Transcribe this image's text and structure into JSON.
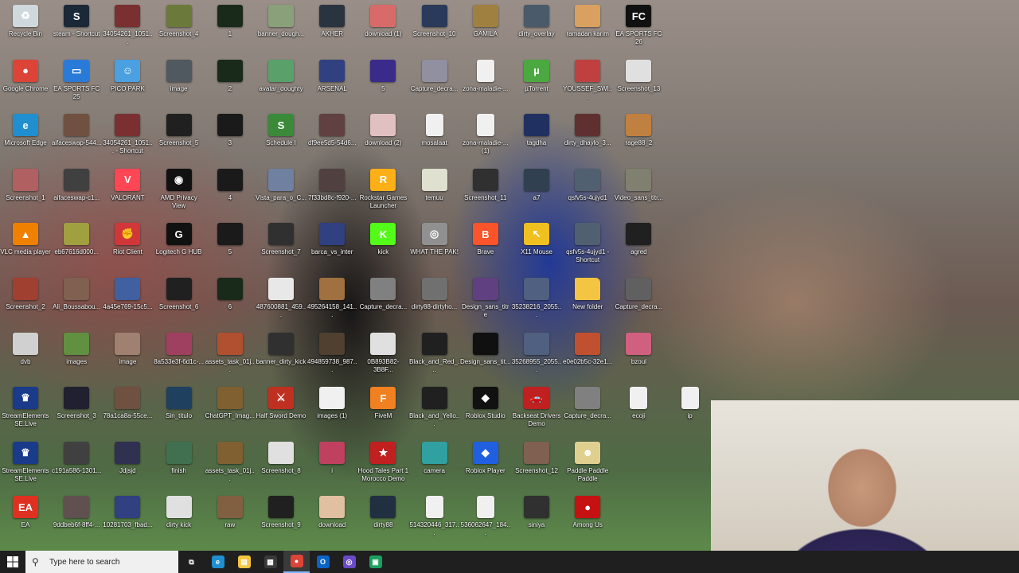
{
  "desktop": {
    "icons": [
      {
        "label": "Recycle Bin",
        "icon": "recycle-bin-icon",
        "color": "#cfd8dc",
        "glyph": "♻"
      },
      {
        "label": "steam - Shortcut",
        "icon": "steam-icon",
        "color": "#1b2838",
        "glyph": "S"
      },
      {
        "label": "34054261_1051...",
        "icon": "image-file-icon",
        "color": "#7a3030",
        "glyph": ""
      },
      {
        "label": "Screenshot_4",
        "icon": "image-file-icon",
        "color": "#6b7a3a",
        "glyph": ""
      },
      {
        "label": "1",
        "icon": "image-file-icon",
        "color": "#1a2a1a",
        "glyph": ""
      },
      {
        "label": "banner_dough...",
        "icon": "image-file-icon",
        "color": "#8aa07a",
        "glyph": ""
      },
      {
        "label": "AKHER",
        "icon": "image-file-icon",
        "color": "#2a3340",
        "glyph": ""
      },
      {
        "label": "download (1)",
        "icon": "image-file-icon",
        "color": "#d86a6a",
        "glyph": ""
      },
      {
        "label": "Screenshot_10",
        "icon": "image-file-icon",
        "color": "#2a3a5a",
        "glyph": ""
      },
      {
        "label": "GAMILA",
        "icon": "image-file-icon",
        "color": "#a08040",
        "glyph": ""
      },
      {
        "label": "dirty_overlay",
        "icon": "image-file-icon",
        "color": "#4a5a6a",
        "glyph": ""
      },
      {
        "label": "ramadan karim",
        "icon": "image-file-icon",
        "color": "#d9a060",
        "glyph": ""
      },
      {
        "label": "EA SPORTS FC 26",
        "icon": "ea-fc-icon",
        "color": "#111111",
        "glyph": "FC"
      },
      {
        "label": "Google Chrome",
        "icon": "chrome-icon",
        "color": "#db4437",
        "glyph": "●"
      },
      {
        "label": "EA SPORTS FC 25",
        "icon": "shortcut-icon",
        "color": "#2a7ad8",
        "glyph": "▭"
      },
      {
        "label": "PICO PARK",
        "icon": "pico-park-icon",
        "color": "#4aa0e0",
        "glyph": "☺"
      },
      {
        "label": "image",
        "icon": "image-file-icon",
        "color": "#505860",
        "glyph": ""
      },
      {
        "label": "2",
        "icon": "image-file-icon",
        "color": "#1a2a1a",
        "glyph": ""
      },
      {
        "label": "avatar_doughty",
        "icon": "image-file-icon",
        "color": "#5aa06a",
        "glyph": ""
      },
      {
        "label": "ARSENAL",
        "icon": "image-file-icon",
        "color": "#304080",
        "glyph": ""
      },
      {
        "label": "5",
        "icon": "image-file-icon",
        "color": "#3a2a8a",
        "glyph": ""
      },
      {
        "label": "Capture_decra...",
        "icon": "image-file-icon",
        "color": "#9090a0",
        "glyph": ""
      },
      {
        "label": "zona-maladie-...",
        "icon": "file-icon",
        "color": "#f0f0f0",
        "glyph": ""
      },
      {
        "label": "µTorrent",
        "icon": "utorrent-icon",
        "color": "#4ca840",
        "glyph": "µ"
      },
      {
        "label": "YOUSSEF_SWI...",
        "icon": "image-file-icon",
        "color": "#c04040",
        "glyph": ""
      },
      {
        "label": "Screenshot_13",
        "icon": "image-file-icon",
        "color": "#e0e0e0",
        "glyph": ""
      },
      {
        "label": "Microsoft Edge",
        "icon": "edge-icon",
        "color": "#1f8fd0",
        "glyph": "e"
      },
      {
        "label": "aifaceswap-544...",
        "icon": "image-file-icon",
        "color": "#705040",
        "glyph": ""
      },
      {
        "label": "34054261_1051... - Shortcut",
        "icon": "image-file-icon",
        "color": "#7a3030",
        "glyph": ""
      },
      {
        "label": "Screenshot_5",
        "icon": "image-file-icon",
        "color": "#202020",
        "glyph": ""
      },
      {
        "label": "3",
        "icon": "image-file-icon",
        "color": "#1a1a1a",
        "glyph": ""
      },
      {
        "label": "Schedule I",
        "icon": "schedule-icon",
        "color": "#3a8a3a",
        "glyph": "S"
      },
      {
        "label": "df9ee5d5-54d6...",
        "icon": "image-file-icon",
        "color": "#604040",
        "glyph": ""
      },
      {
        "label": "download (2)",
        "icon": "image-file-icon",
        "color": "#e0c0c0",
        "glyph": ""
      },
      {
        "label": "mosalaat",
        "icon": "file-icon",
        "color": "#f0f0f0",
        "glyph": ""
      },
      {
        "label": "zona-maladie-... (1)",
        "icon": "file-icon",
        "color": "#f0f0f0",
        "glyph": ""
      },
      {
        "label": "tagdha",
        "icon": "image-file-icon",
        "color": "#203060",
        "glyph": ""
      },
      {
        "label": "dirty_dhaylo_3...",
        "icon": "image-file-icon",
        "color": "#603030",
        "glyph": ""
      },
      {
        "label": "rage88_2",
        "icon": "image-file-icon",
        "color": "#c08040",
        "glyph": ""
      },
      {
        "label": "Screenshot_1",
        "icon": "image-file-icon",
        "color": "#b06060",
        "glyph": ""
      },
      {
        "label": "aifaceswap-c1...",
        "icon": "image-file-icon",
        "color": "#404040",
        "glyph": ""
      },
      {
        "label": "VALORANT",
        "icon": "valorant-icon",
        "color": "#ff4655",
        "glyph": "V"
      },
      {
        "label": "AMD Privacy View",
        "icon": "amd-icon",
        "color": "#111111",
        "glyph": "◉"
      },
      {
        "label": "4",
        "icon": "image-file-icon",
        "color": "#1a1a1a",
        "glyph": ""
      },
      {
        "label": "Vista_para_o_C...",
        "icon": "image-file-icon",
        "color": "#7080a0",
        "glyph": ""
      },
      {
        "label": "7f33bd8c-f920-...",
        "icon": "image-file-icon",
        "color": "#504040",
        "glyph": ""
      },
      {
        "label": "Rockstar Games Launcher",
        "icon": "rockstar-icon",
        "color": "#fcaf17",
        "glyph": "R"
      },
      {
        "label": "temuu",
        "icon": "image-file-icon",
        "color": "#e0e0d0",
        "glyph": ""
      },
      {
        "label": "Screenshot_11",
        "icon": "image-file-icon",
        "color": "#303030",
        "glyph": ""
      },
      {
        "label": "a7",
        "icon": "image-file-icon",
        "color": "#304050",
        "glyph": ""
      },
      {
        "label": "qsfv5s-4ujyd1",
        "icon": "image-file-icon",
        "color": "#506070",
        "glyph": ""
      },
      {
        "label": "Video_sans_titr...",
        "icon": "image-file-icon",
        "color": "#808070",
        "glyph": ""
      },
      {
        "label": "VLC media player",
        "icon": "vlc-icon",
        "color": "#f08000",
        "glyph": "▲"
      },
      {
        "label": "eb67616d000...",
        "icon": "image-file-icon",
        "color": "#a0a040",
        "glyph": ""
      },
      {
        "label": "Riot Client",
        "icon": "riot-icon",
        "color": "#d13639",
        "glyph": "✊"
      },
      {
        "label": "Logitech G HUB",
        "icon": "logitech-icon",
        "color": "#111111",
        "glyph": "G"
      },
      {
        "label": "5",
        "icon": "image-file-icon",
        "color": "#1a1a1a",
        "glyph": ""
      },
      {
        "label": "Screenshot_7",
        "icon": "image-file-icon",
        "color": "#303030",
        "glyph": ""
      },
      {
        "label": "barca_vs_inter",
        "icon": "image-file-icon",
        "color": "#304080",
        "glyph": ""
      },
      {
        "label": "kick",
        "icon": "kick-icon",
        "color": "#53fc18",
        "glyph": "K"
      },
      {
        "label": "WHAT THE PAK!",
        "icon": "game-icon",
        "color": "#909090",
        "glyph": "◎"
      },
      {
        "label": "Brave",
        "icon": "brave-icon",
        "color": "#fb542b",
        "glyph": "B"
      },
      {
        "label": "X11 Mouse",
        "icon": "cursor-icon",
        "color": "#f0c020",
        "glyph": "↖"
      },
      {
        "label": "qsfv5s-4ujyd1 - Shortcut",
        "icon": "image-file-icon",
        "color": "#506070",
        "glyph": ""
      },
      {
        "label": "agred",
        "icon": "image-file-icon",
        "color": "#202020",
        "glyph": ""
      },
      {
        "label": "Screenshot_2",
        "icon": "image-file-icon",
        "color": "#a04030",
        "glyph": ""
      },
      {
        "label": "Ali_Boussabou...",
        "icon": "image-file-icon",
        "color": "#806050",
        "glyph": ""
      },
      {
        "label": "4a45e769-15c5...",
        "icon": "image-file-icon",
        "color": "#4060a0",
        "glyph": ""
      },
      {
        "label": "Screenshot_6",
        "icon": "image-file-icon",
        "color": "#202020",
        "glyph": ""
      },
      {
        "label": "6",
        "icon": "image-file-icon",
        "color": "#1a2a1a",
        "glyph": ""
      },
      {
        "label": "487600881_459...",
        "icon": "image-file-icon",
        "color": "#e8e8e8",
        "glyph": ""
      },
      {
        "label": "495264158_141...",
        "icon": "image-file-icon",
        "color": "#a07040",
        "glyph": ""
      },
      {
        "label": "Capture_decra...",
        "icon": "image-file-icon",
        "color": "#808080",
        "glyph": ""
      },
      {
        "label": "dirty88-dirtyho...",
        "icon": "image-file-icon",
        "color": "#707070",
        "glyph": ""
      },
      {
        "label": "Design_sans_titre",
        "icon": "image-file-icon",
        "color": "#604080",
        "glyph": ""
      },
      {
        "label": "35238216_2055...",
        "icon": "image-file-icon",
        "color": "#506080",
        "glyph": ""
      },
      {
        "label": "New folder",
        "icon": "folder-icon",
        "color": "#f4c542",
        "glyph": ""
      },
      {
        "label": "Capture_decra...",
        "icon": "image-file-icon",
        "color": "#606060",
        "glyph": ""
      },
      {
        "label": "dvb",
        "icon": "image-file-icon",
        "color": "#d0d0d0",
        "glyph": ""
      },
      {
        "label": "images",
        "icon": "image-file-icon",
        "color": "#609040",
        "glyph": ""
      },
      {
        "label": "image",
        "icon": "image-file-icon",
        "color": "#a08070",
        "glyph": ""
      },
      {
        "label": "8a533e3f-6d1c-...",
        "icon": "image-file-icon",
        "color": "#a04060",
        "glyph": ""
      },
      {
        "label": "assets_task_01j...",
        "icon": "image-file-icon",
        "color": "#b05030",
        "glyph": ""
      },
      {
        "label": "banner_dirty_kick",
        "icon": "image-file-icon",
        "color": "#303030",
        "glyph": ""
      },
      {
        "label": "494859738_987...",
        "icon": "image-file-icon",
        "color": "#504030",
        "glyph": ""
      },
      {
        "label": "0B893B82-3B8F...",
        "icon": "image-file-icon",
        "color": "#e0e0e0",
        "glyph": ""
      },
      {
        "label": "Black_and_Red_...",
        "icon": "image-file-icon",
        "color": "#202020",
        "glyph": ""
      },
      {
        "label": "Design_sans_tit...",
        "icon": "image-file-icon",
        "color": "#101010",
        "glyph": ""
      },
      {
        "label": "35268955_2055...",
        "icon": "image-file-icon",
        "color": "#506080",
        "glyph": ""
      },
      {
        "label": "e0e02b5c-32e1...",
        "icon": "image-file-icon",
        "color": "#c05030",
        "glyph": ""
      },
      {
        "label": "bzoul",
        "icon": "image-file-icon",
        "color": "#d06080",
        "glyph": ""
      },
      {
        "label": "StreamElements SE.Live",
        "icon": "streamelements-icon",
        "color": "#1a3a8a",
        "glyph": "♛"
      },
      {
        "label": "Screenshot_3",
        "icon": "image-file-icon",
        "color": "#202030",
        "glyph": ""
      },
      {
        "label": "78a1ca8a-55ce...",
        "icon": "image-file-icon",
        "color": "#705040",
        "glyph": ""
      },
      {
        "label": "Sin_titulo",
        "icon": "image-file-icon",
        "color": "#204060",
        "glyph": ""
      },
      {
        "label": "ChatGPT_Imag...",
        "icon": "image-file-icon",
        "color": "#806030",
        "glyph": ""
      },
      {
        "label": "Half Sword Demo",
        "icon": "half-sword-icon",
        "color": "#c03020",
        "glyph": "⚔"
      },
      {
        "label": "images (1)",
        "icon": "image-file-icon",
        "color": "#f0f0f0",
        "glyph": ""
      },
      {
        "label": "FiveM",
        "icon": "fivem-icon",
        "color": "#f08020",
        "glyph": "F"
      },
      {
        "label": "Black_and_Yello...",
        "icon": "image-file-icon",
        "color": "#202020",
        "glyph": ""
      },
      {
        "label": "Roblox Studio",
        "icon": "roblox-studio-icon",
        "color": "#111111",
        "glyph": "◆"
      },
      {
        "label": "Backseat Drivers Demo",
        "icon": "game-icon",
        "color": "#c02020",
        "glyph": "🚗"
      },
      {
        "label": "Capture_decra...",
        "icon": "image-file-icon",
        "color": "#808080",
        "glyph": ""
      },
      {
        "label": "ecoji",
        "icon": "file-icon",
        "color": "#f0f0f0",
        "glyph": ""
      },
      {
        "label": "ip",
        "icon": "file-icon",
        "color": "#f0f0f0",
        "glyph": ""
      },
      {
        "label": "StreamElements SE.Live",
        "icon": "streamelements-icon",
        "color": "#1a3a8a",
        "glyph": "♛"
      },
      {
        "label": "c191a586-1301...",
        "icon": "image-file-icon",
        "color": "#404040",
        "glyph": ""
      },
      {
        "label": "Jdjsjd",
        "icon": "image-file-icon",
        "color": "#303050",
        "glyph": ""
      },
      {
        "label": "finish",
        "icon": "image-file-icon",
        "color": "#407050",
        "glyph": ""
      },
      {
        "label": "assets_task_01j...",
        "icon": "image-file-icon",
        "color": "#806030",
        "glyph": ""
      },
      {
        "label": "Screenshot_8",
        "icon": "image-file-icon",
        "color": "#e0e0e0",
        "glyph": ""
      },
      {
        "label": "i",
        "icon": "image-file-icon",
        "color": "#c04060",
        "glyph": ""
      },
      {
        "label": "Hood Tales Part 1 Morocco Demo",
        "icon": "game-icon",
        "color": "#c02020",
        "glyph": "★"
      },
      {
        "label": "camera",
        "icon": "image-file-icon",
        "color": "#30a0a0",
        "glyph": ""
      },
      {
        "label": "Roblox Player",
        "icon": "roblox-icon",
        "color": "#2060e0",
        "glyph": "◆"
      },
      {
        "label": "Screenshot_12",
        "icon": "image-file-icon",
        "color": "#806050",
        "glyph": ""
      },
      {
        "label": "Paddle Paddle Paddle",
        "icon": "game-icon",
        "color": "#e0d090",
        "glyph": "☻"
      },
      {
        "label": "EA",
        "icon": "ea-icon",
        "color": "#e03020",
        "glyph": "EA"
      },
      {
        "label": "9ddbeb6f-8ff4-...",
        "icon": "image-file-icon",
        "color": "#605050",
        "glyph": ""
      },
      {
        "label": "10281703_fbad...",
        "icon": "image-file-icon",
        "color": "#304080",
        "glyph": ""
      },
      {
        "label": "dirty kick",
        "icon": "image-file-icon",
        "color": "#e0e0e0",
        "glyph": ""
      },
      {
        "label": "raw",
        "icon": "image-file-icon",
        "color": "#806040",
        "glyph": ""
      },
      {
        "label": "Screenshot_9",
        "icon": "image-file-icon",
        "color": "#202020",
        "glyph": ""
      },
      {
        "label": "download",
        "icon": "image-file-icon",
        "color": "#e0c0a0",
        "glyph": ""
      },
      {
        "label": "dirty88",
        "icon": "image-file-icon",
        "color": "#203040",
        "glyph": ""
      },
      {
        "label": "514320446_317...",
        "icon": "file-icon",
        "color": "#f0f0f0",
        "glyph": ""
      },
      {
        "label": "536062647_184...",
        "icon": "file-icon",
        "color": "#f0f0f0",
        "glyph": ""
      },
      {
        "label": "siniya",
        "icon": "image-file-icon",
        "color": "#303030",
        "glyph": ""
      },
      {
        "label": "Among Us",
        "icon": "among-us-icon",
        "color": "#c51111",
        "glyph": "●"
      }
    ]
  },
  "taskbar": {
    "search_placeholder": "Type here to search",
    "apps": [
      {
        "name": "task-view-icon",
        "glyph": "⧉",
        "color": "#1f1f1f",
        "active": false
      },
      {
        "name": "edge-taskbar-icon",
        "glyph": "e",
        "color": "#1f8fd0",
        "active": false
      },
      {
        "name": "file-explorer-icon",
        "glyph": "▤",
        "color": "#f4c542",
        "active": false
      },
      {
        "name": "store-icon",
        "glyph": "▦",
        "color": "#3a3a3a",
        "active": false
      },
      {
        "name": "chrome-taskbar-icon",
        "glyph": "●",
        "color": "#db4437",
        "active": true
      },
      {
        "name": "outlook-icon",
        "glyph": "O",
        "color": "#0a64c8",
        "active": false
      },
      {
        "name": "app-icon",
        "glyph": "◎",
        "color": "#6a4ac8",
        "active": false
      },
      {
        "name": "calculator-icon",
        "glyph": "▣",
        "color": "#1aa060",
        "active": false
      }
    ]
  }
}
